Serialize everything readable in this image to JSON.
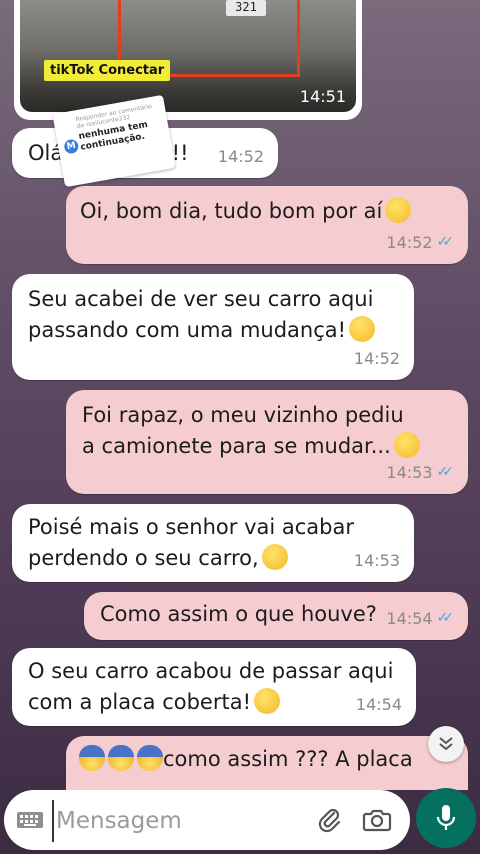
{
  "video": {
    "badge": "tikTok Conectar",
    "time": "14:51",
    "plate": "321"
  },
  "reply_sticker": {
    "header": "Responder ao comentário de rosilucente232",
    "avatar_letter": "M",
    "text": "nenhuma tem continuação."
  },
  "messages": [
    {
      "text": "Olá",
      "suffix": "!!!",
      "time": "14:52",
      "direction": "in"
    },
    {
      "text": "Oi, bom dia, tudo bom por aí",
      "time": "14:52",
      "direction": "out",
      "emoji": "smiling-face"
    },
    {
      "line1": "Seu acabei de ver seu carro aqui",
      "line2": "passando com uma mudança!",
      "time": "14:52",
      "direction": "in",
      "emoji": "raised-eyebrow-face"
    },
    {
      "line1": "Foi rapaz, o meu vizinho pediu",
      "line2": "a camionete para se mudar...",
      "time": "14:53",
      "direction": "out",
      "emoji": "relieved-face"
    },
    {
      "line1": "Poisé mais o senhor vai acabar",
      "line2": "perdendo o seu carro,",
      "time": "14:53",
      "direction": "in",
      "emoji": "raised-eyebrow-face"
    },
    {
      "text": "Como assim o que houve?",
      "time": "14:54",
      "direction": "out"
    },
    {
      "line1": "O seu carro acabou de passar aqui",
      "line2": "com a placa coberta!",
      "time": "14:54",
      "direction": "in",
      "emoji": "grinning-sweat-face"
    },
    {
      "text": "como assim ??? A placa",
      "direction": "out",
      "emoji": "fearful-face"
    }
  ],
  "input": {
    "placeholder": "Mensagem"
  },
  "icons": {
    "keyboard": "keyboard-icon",
    "attach": "paperclip-icon",
    "camera": "camera-icon",
    "mic": "mic-icon",
    "scroll": "double-chevron-down-icon",
    "read_receipt": "double-check-icon"
  },
  "colors": {
    "outgoing_bubble": "#f5cdd0",
    "incoming_bubble": "#ffffff",
    "read_ticks": "#4aa3df",
    "mic_button": "#06705f"
  }
}
